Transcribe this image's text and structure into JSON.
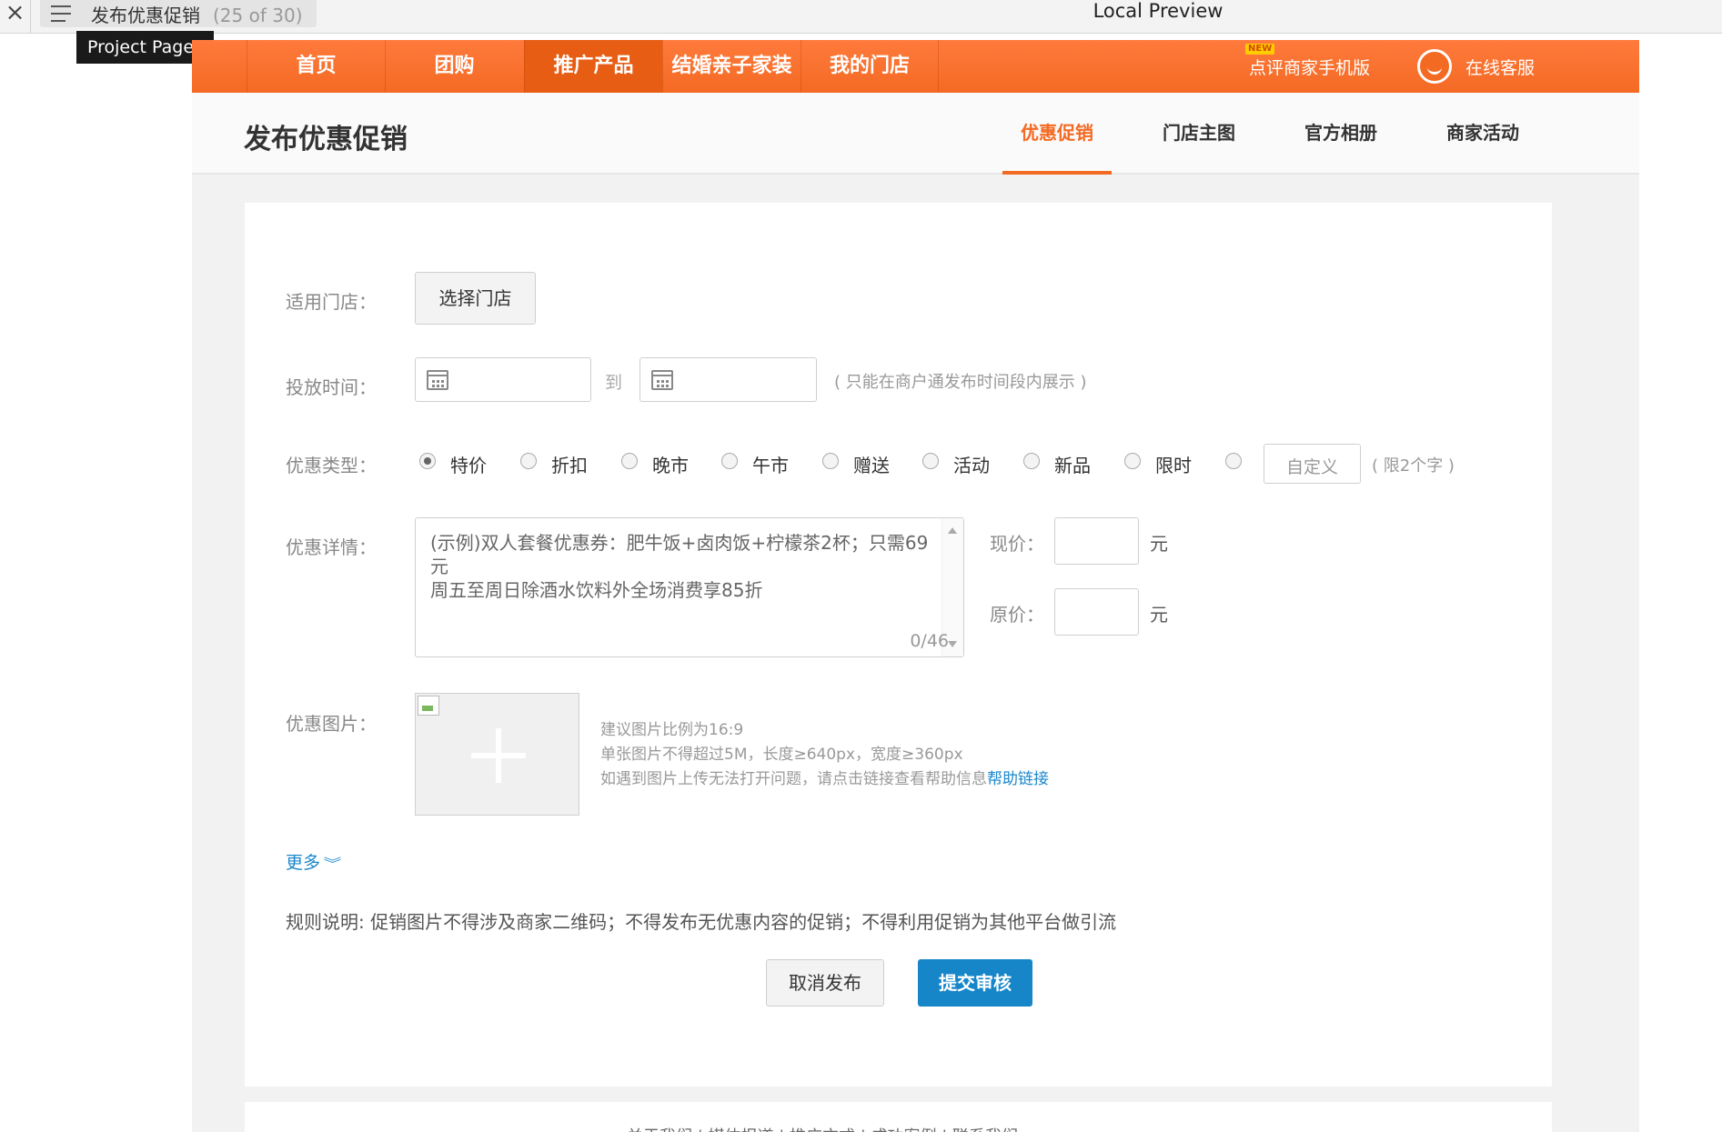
{
  "preview": {
    "close_glyph": "×",
    "page_title": "发布优惠促销",
    "page_count": "(25 of 30)",
    "window_title": "Local Preview",
    "tooltip": "Project Pages"
  },
  "nav": {
    "items": [
      {
        "label": "首页"
      },
      {
        "label": "团购"
      },
      {
        "label": "推广产品",
        "active": true
      },
      {
        "label": "结婚亲子家装"
      },
      {
        "label": "我的门店"
      }
    ],
    "new_badge": "NEW",
    "mobile_label": "点评商家手机版",
    "service_label": "在线客服"
  },
  "subheader": {
    "title": "发布优惠促销",
    "tabs": [
      {
        "label": "优惠促销",
        "active": true
      },
      {
        "label": "门店主图"
      },
      {
        "label": "官方相册"
      },
      {
        "label": "商家活动"
      }
    ]
  },
  "form": {
    "store": {
      "label": "适用门店：",
      "button": "选择门店"
    },
    "time": {
      "label": "投放时间：",
      "start_value": "",
      "end_value": "",
      "separator": "到",
      "hint": "( 只能在商户通发布时间段内展示 )"
    },
    "type": {
      "label": "优惠类型：",
      "options": [
        "特价",
        "折扣",
        "晚市",
        "午市",
        "赠送",
        "活动",
        "新品",
        "限时"
      ],
      "selected": "特价",
      "custom_placeholder": "自定义",
      "custom_hint": "( 限2个字 )"
    },
    "detail": {
      "label": "优惠详情：",
      "placeholder": "(示例)双人套餐优惠券：肥牛饭+卤肉饭+柠檬茶2杯；只需69元\n周五至周日除酒水饮料外全场消费享85折",
      "counter": "0/46",
      "current_price_label": "现价：",
      "original_price_label": "原价：",
      "current_price_value": "",
      "original_price_value": "",
      "unit": "元"
    },
    "image": {
      "label": "优惠图片：",
      "hint_1": "建议图片比例为16:9",
      "hint_2": "单张图片不得超过5M，长度≥640px，宽度≥360px",
      "hint_3": "如遇到图片上传无法打开问题，请点击链接查看帮助信息",
      "help_link": "帮助链接"
    },
    "more": "更多",
    "rule": "规则说明:   促销图片不得涉及商家二维码；不得发布无优惠内容的促销；不得利用促销为其他平台做引流",
    "cancel_button": "取消发布",
    "submit_button": "提交审核"
  },
  "footer": {
    "text": "关于我们   |   媒体报道   |   推广方式   |   成功案例   |   联系我们"
  },
  "colors": {
    "accent": "#f36a23",
    "link": "#1a87cc",
    "submit": "#1686c9"
  }
}
